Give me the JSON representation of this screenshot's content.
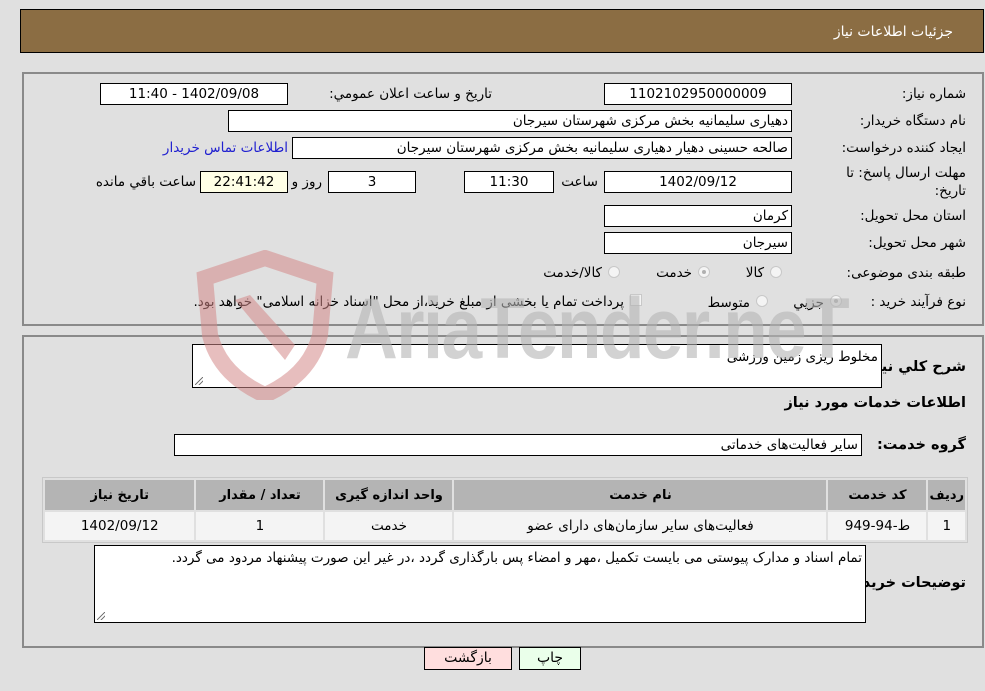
{
  "header": {
    "title": "جزئیات اطلاعات نیاز"
  },
  "details": {
    "need_number": {
      "label": "شماره نیاز:",
      "value": "1102102950000009"
    },
    "announce_datetime": {
      "label": "تاریخ و ساعت اعلان عمومي:",
      "value": "1402/09/08 - 11:40"
    },
    "buyer_org": {
      "label": "نام دستگاه خریدار:",
      "value": "دهیاری سلیمانیه بخش مرکزی شهرستان سیرجان"
    },
    "requester": {
      "label": "ایجاد کننده درخواست:",
      "value": "صالحه حسینی دهیار دهیاری سلیمانیه بخش مرکزی شهرستان سیرجان"
    },
    "buyer_contact_link": "اطلاعات تماس خریدار",
    "deadline": {
      "label_line1": "مهلت ارسال پاسخ: تا",
      "label_line2": "تاریخ:",
      "date": "1402/09/12",
      "time_label": "ساعت",
      "time": "11:30",
      "days": "3",
      "days_label": "روز و",
      "remaining": "22:41:42",
      "remaining_label": "ساعت باقي مانده"
    },
    "province": {
      "label": "استان محل تحویل:",
      "value": "کرمان"
    },
    "city": {
      "label": "شهر محل تحویل:",
      "value": "سیرجان"
    },
    "category": {
      "label": "طبقه بندی موضوعی:",
      "options": [
        "کالا",
        "خدمت",
        "کالا/خدمت"
      ],
      "selected": "خدمت"
    },
    "purchase_type": {
      "label": "نوع فرآیند خرید :",
      "options": [
        "جزيي",
        "متوسط"
      ],
      "selected": "جزيي",
      "treasury_note": "پرداخت تمام یا بخشی از مبلغ خرید،از محل \"اسناد خزانه اسلامی\" خواهد بود."
    }
  },
  "general_description": {
    "label": "شرح کلي نیاز:",
    "value": "مخلوط ریزی زمین ورزشی"
  },
  "services_section_title": "اطلاعات خدمات مورد نیاز",
  "service_group": {
    "label": "گروه خدمت:",
    "value": "سایر فعالیت‌های خدماتی"
  },
  "services_table": {
    "headers": [
      "ردیف",
      "کد خدمت",
      "نام خدمت",
      "واحد اندازه گیری",
      "تعداد / مقدار",
      "تاریخ نیاز"
    ],
    "rows": [
      [
        "1",
        "ط-94-949",
        "فعالیت‌های سایر سازمان‌های دارای عضو",
        "خدمت",
        "1",
        "1402/09/12"
      ]
    ]
  },
  "buyer_notes": {
    "label": "توضیحات خریدار:",
    "value": "تمام اسناد و مدارک پیوستی می بایست تکمیل ،مهر و امضاء پس بارگذاری گردد ،در غیر این صورت پیشنهاد مردود می گردد."
  },
  "buttons": {
    "print": "چاپ",
    "back": "بازگشت"
  },
  "watermark": "AriaTender.neT",
  "colors": {
    "header_bg": "#8b6d43",
    "print_bg": "#eaffea",
    "back_bg": "#ffdede",
    "link": "#2020d0"
  }
}
